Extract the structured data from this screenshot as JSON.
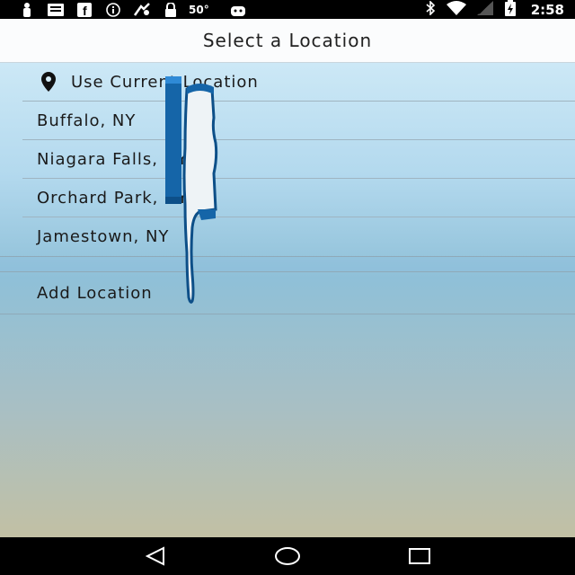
{
  "status_bar": {
    "temperature": "50°",
    "time": "2:58",
    "icons": [
      "person-icon",
      "message-icon",
      "facebook-icon",
      "info-icon",
      "fax-icon",
      "lock-icon",
      "temperature",
      "android-icon"
    ],
    "right_icons": [
      "bluetooth-icon",
      "wifi-icon",
      "signal-icon",
      "battery-icon"
    ]
  },
  "header": {
    "title": "Select a Location"
  },
  "locations": {
    "current": "Use Current Location",
    "items": [
      "Buffalo, NY",
      "Niagara Falls, NY",
      "Orchard Park, NY",
      "Jamestown, NY"
    ]
  },
  "add_location": "Add Location",
  "nav": {
    "buttons": [
      "back-icon",
      "home-icon",
      "recents-icon"
    ]
  },
  "colors": {
    "accent": "#1565a8",
    "title_bg": "#fbfcfd"
  }
}
